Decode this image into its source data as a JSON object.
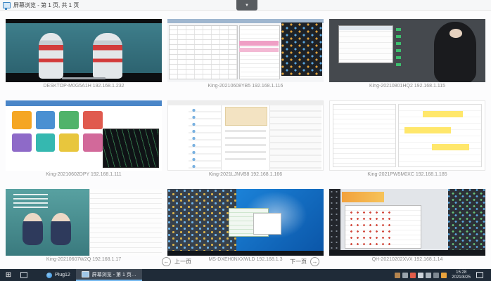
{
  "window": {
    "title": "屏幕浏览 - 第 1 页, 共 1 页"
  },
  "toolbar": {
    "chevron": "▼"
  },
  "grid": {
    "items": [
      {
        "label": "DESKTOP-M0G5A1H 192.168.1.232"
      },
      {
        "label": "King-20210608YB5 192.168.1.116"
      },
      {
        "label": "King-20210801HQ2 192.168.1.115"
      },
      {
        "label": "King-20210602DPY 192.168.1.111"
      },
      {
        "label": "King-2021LJNVB8 192.168.1.166"
      },
      {
        "label": "King-2021PW5M0XC 192.168.1.185"
      },
      {
        "label": "King-20210607W2Q 192.168.1.17"
      },
      {
        "label": "MS-DXEH0NXXWLD 192.168.1.3"
      },
      {
        "label": "QH-20210202XVX 192.168.1.14"
      }
    ]
  },
  "pager": {
    "prev_label": "上一页",
    "next_label": "下一页",
    "arrow_left": "←",
    "arrow_right": "→"
  },
  "taskbar": {
    "start_glyph": "⊞",
    "apps": [
      {
        "label": "Plug12"
      },
      {
        "label": "屏幕浏览 - 第 1 页…"
      }
    ],
    "clock": {
      "time": "15:28",
      "date": "2021/8/25"
    }
  },
  "colors": {
    "taskbar": "#1f2b38",
    "accent_blue": "#2f8fe0",
    "caption_gray": "#8f8f8f",
    "highlight_yellow": "#ffe76b"
  }
}
